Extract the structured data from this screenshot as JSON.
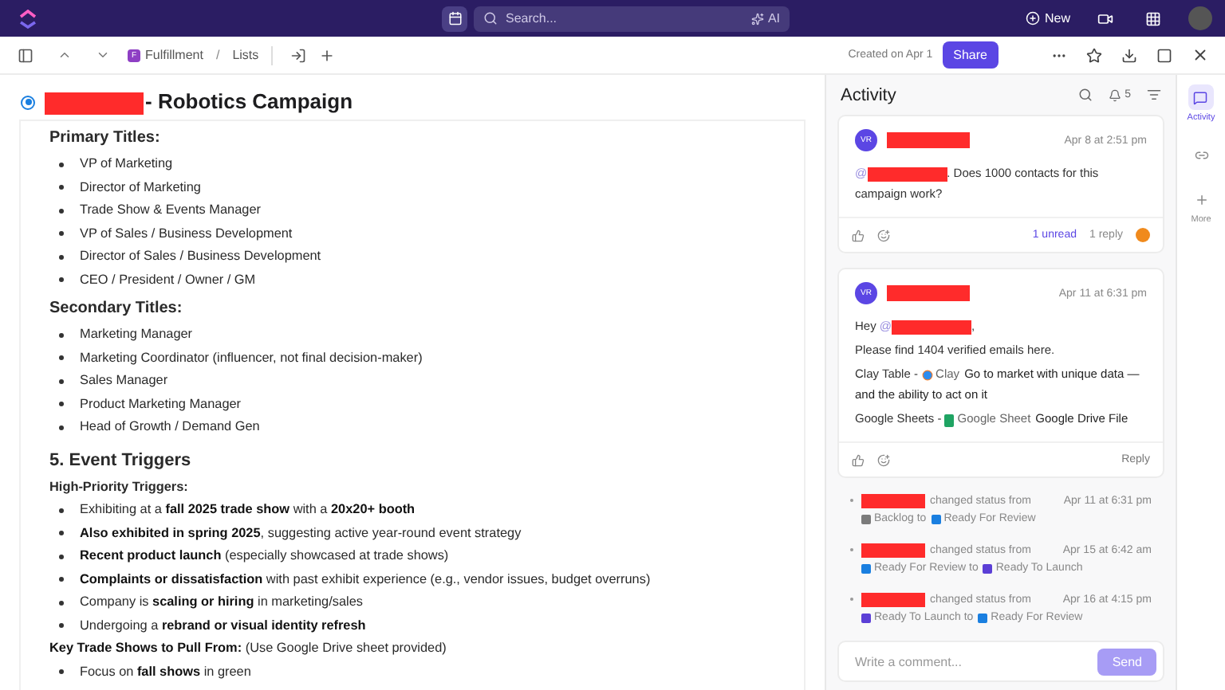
{
  "top_bar": {
    "search_placeholder": "Search...",
    "ai_label": "AI",
    "new_button": "New"
  },
  "toolbar": {
    "breadcrumb": [
      {
        "label": "Fulfillment",
        "badge": "F"
      },
      {
        "label": "Lists"
      }
    ],
    "separator": "/",
    "created": "Created on Apr 1",
    "share": "Share"
  },
  "document": {
    "title": "- Robotics Campaign",
    "title_redacted": true,
    "blocks": [
      {
        "kind": "subheading",
        "text": "Primary Titles:"
      },
      {
        "kind": "bullet",
        "text": "VP of Marketing"
      },
      {
        "kind": "bullet",
        "text": "Director of Marketing"
      },
      {
        "kind": "bullet",
        "text": "Trade Show & Events Manager"
      },
      {
        "kind": "bullet",
        "text": "VP of Sales / Business Development"
      },
      {
        "kind": "bullet",
        "text": "Director of Sales / Business Development"
      },
      {
        "kind": "bullet",
        "text": "CEO / President / Owner / GM"
      },
      {
        "kind": "subheading",
        "text": "Secondary Titles:"
      },
      {
        "kind": "bullet",
        "text": "Marketing Manager"
      },
      {
        "kind": "bullet",
        "text": "Marketing Coordinator (influencer, not final decision-maker)"
      },
      {
        "kind": "bullet",
        "text": "Sales Manager"
      },
      {
        "kind": "bullet",
        "text": "Product Marketing Manager"
      },
      {
        "kind": "bullet",
        "text": "Head of Growth / Demand Gen"
      },
      {
        "kind": "heading",
        "text": "5. Event Triggers"
      },
      {
        "kind": "label",
        "text": "High-Priority Triggers:"
      },
      {
        "kind": "bullet",
        "text": "Exhibiting at a **fall 2025 trade show** with a **20x20+ booth**"
      },
      {
        "kind": "bullet",
        "text": "**Also exhibited in spring 2025**, suggesting active year-round event strategy"
      },
      {
        "kind": "bullet",
        "text": "**Recent product launch** (especially showcased at trade shows)"
      },
      {
        "kind": "bullet",
        "text": "**Complaints or dissatisfaction** with past exhibit experience (e.g., vendor issues, budget overruns)"
      },
      {
        "kind": "bullet",
        "text": "Company is **scaling or hiring** in marketing/sales"
      },
      {
        "kind": "bullet",
        "text": "Undergoing a **rebrand or visual identity refresh**"
      },
      {
        "kind": "paragraph",
        "text": "**Key Trade Shows to Pull From:** (Use Google Drive sheet provided)"
      },
      {
        "kind": "bullet",
        "text": "Focus on **fall shows** in green"
      }
    ]
  },
  "activity": {
    "title": "Activity",
    "notification_count": "5",
    "comments": [
      {
        "avatar": "VR",
        "time": "Apr 8 at 2:51 pm",
        "lines": [
          [
            {
              "kind": "mention",
              "text": "@"
            },
            {
              "kind": "redacted"
            },
            {
              "kind": "text",
              "text": ". Does 1000 contacts for this campaign work?"
            }
          ]
        ],
        "unread": "1 unread",
        "replies": "1 reply"
      },
      {
        "avatar": "VR",
        "time": "Apr 11 at 6:31 pm",
        "lines": [
          [
            {
              "kind": "text",
              "text": "Hey "
            },
            {
              "kind": "mention",
              "text": "@"
            },
            {
              "kind": "redacted"
            },
            {
              "kind": "text",
              "text": ","
            }
          ],
          [
            {
              "kind": "text",
              "text": "Please find 1404 verified emails here."
            }
          ],
          [
            {
              "kind": "text",
              "text": "Clay Table - "
            },
            {
              "kind": "clay_app",
              "text": "Clay"
            },
            {
              "kind": "bold",
              "text": "Go to market with unique data —"
            },
            {
              "kind": "bold",
              "text": "and the ability to act on it"
            }
          ],
          [
            {
              "kind": "text",
              "text": "Google Sheets - "
            },
            {
              "kind": "sheet_app",
              "text": "Google Sheet"
            },
            {
              "kind": "bold",
              "text": "Google Drive File"
            }
          ]
        ],
        "reply": "Reply"
      }
    ],
    "events": [
      {
        "time": "Apr 11 at 6:31 pm",
        "action": "changed status from",
        "from": {
          "label": "Backlog",
          "color": "#7b7b7b"
        },
        "connector": "to",
        "to": {
          "label": "Ready For Review",
          "color": "#1a7fe0"
        }
      },
      {
        "time": "Apr 15 at 6:42 am",
        "action": "changed status from",
        "from": {
          "label": "Ready For Review",
          "color": "#1a7fe0"
        },
        "connector": "to",
        "to": {
          "label": "Ready To Launch",
          "color": "#5b3fd6"
        }
      },
      {
        "time": "Apr 16 at 4:15 pm",
        "action": "changed status from",
        "from": {
          "label": "Ready To Launch",
          "color": "#5b3fd6"
        },
        "connector": "to",
        "to": {
          "label": "Ready For Review",
          "color": "#1a7fe0"
        }
      }
    ],
    "comment_placeholder": "Write a comment...",
    "send": "Send"
  },
  "rail": [
    {
      "kind": "activity",
      "label": "Activity",
      "selected": true
    },
    {
      "kind": "link",
      "selected": false
    },
    {
      "kind": "more",
      "label": "More",
      "selected": false
    }
  ]
}
